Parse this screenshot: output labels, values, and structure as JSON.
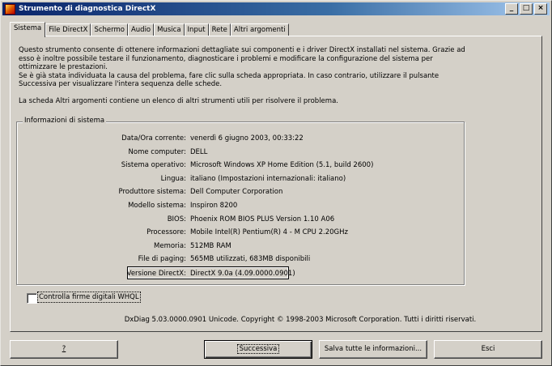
{
  "window": {
    "title": "Strumento di diagnostica DirectX",
    "controls": {
      "minimize": "_",
      "maximize": "□",
      "close": "×"
    }
  },
  "tabs": [
    {
      "label": "Sistema",
      "active": true
    },
    {
      "label": "File DirectX"
    },
    {
      "label": "Schermo"
    },
    {
      "label": "Audio"
    },
    {
      "label": "Musica"
    },
    {
      "label": "Input"
    },
    {
      "label": "Rete"
    },
    {
      "label": "Altri argomenti"
    }
  ],
  "intro": {
    "p1": "Questo strumento consente di ottenere informazioni dettagliate sui componenti e i driver DirectX installati nel sistema. Grazie ad esso è inoltre possibile testare il funzionamento, diagnosticare i problemi e modificare la configurazione del sistema per ottimizzare le prestazioni.",
    "p2": "Se è già stata individuata la causa del problema, fare clic sulla scheda appropriata. In caso contrario, utilizzare il pulsante Successiva per visualizzare l'intera sequenza delle schede.",
    "p3": "La scheda Altri argomenti contiene un elenco di altri strumenti utili per risolvere il problema."
  },
  "group": {
    "label": "Informazioni di sistema",
    "rows": [
      {
        "label": "Data/Ora corrente:",
        "value": "venerdì 6 giugno 2003, 00:33:22"
      },
      {
        "label": "Nome computer:",
        "value": "DELL"
      },
      {
        "label": "Sistema operativo:",
        "value": "Microsoft Windows XP Home Edition (5.1, build 2600)"
      },
      {
        "label": "Lingua:",
        "value": "italiano (Impostazioni internazionali: italiano)"
      },
      {
        "label": "Produttore sistema:",
        "value": "Dell Computer Corporation"
      },
      {
        "label": "Modello sistema:",
        "value": "Inspiron 8200"
      },
      {
        "label": "BIOS:",
        "value": "Phoenix ROM BIOS PLUS Version 1.10 A06"
      },
      {
        "label": "Processore:",
        "value": "Mobile Intel(R) Pentium(R) 4 - M CPU 2.20GHz"
      },
      {
        "label": "Memoria:",
        "value": "512MB RAM"
      },
      {
        "label": "File di paging:",
        "value": "565MB utilizzati, 683MB disponibili"
      },
      {
        "label": "Versione DirectX:",
        "value": "DirectX 9.0a (4.09.0000.0901)"
      }
    ]
  },
  "checkbox": {
    "label": "Controlla firme digitali WHQL",
    "checked": false
  },
  "copyright": "DxDiag 5.03.0000.0901 Unicode. Copyright © 1998-2003 Microsoft Corporation. Tutti i diritti riservati.",
  "buttons": {
    "help": "?",
    "next": "Successiva",
    "save": "Salva tutte le informazioni...",
    "exit": "Esci"
  }
}
